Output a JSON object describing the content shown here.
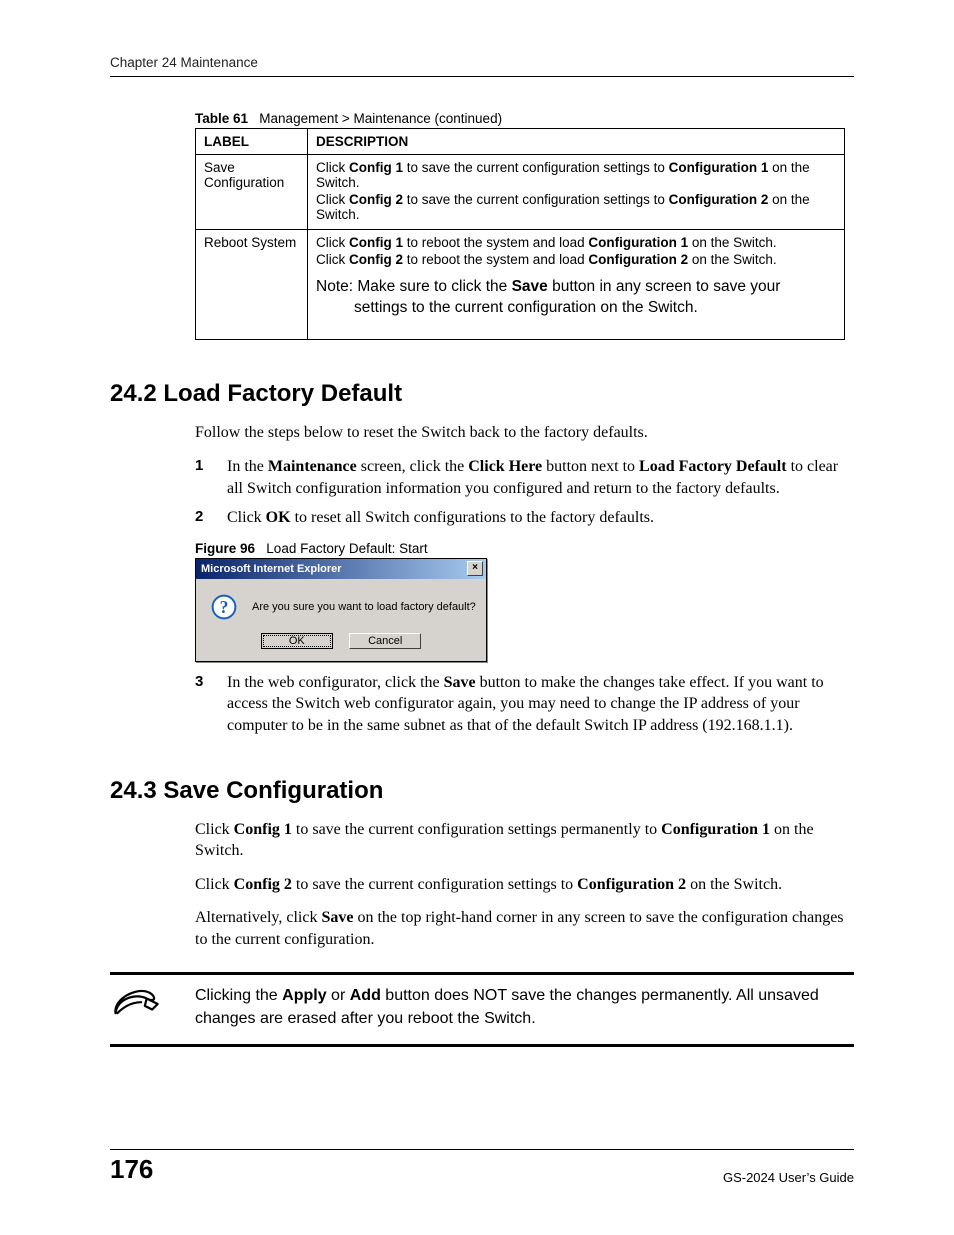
{
  "header": {
    "running": "Chapter 24 Maintenance"
  },
  "table": {
    "caption_label": "Table 61",
    "caption_text": "Management > Maintenance  (continued)",
    "head": {
      "label": "LABEL",
      "desc": "DESCRIPTION"
    },
    "rows": [
      {
        "label": "Save Configuration",
        "d1a": "Click ",
        "d1b": "Config 1",
        "d1c": " to save the current configuration settings to ",
        "d1d": "Configuration 1",
        "d1e": " on the Switch.",
        "d2a": "Click ",
        "d2b": "Config 2",
        "d2c": " to save the current configuration settings to ",
        "d2d": "Configuration 2",
        "d2e": " on the Switch."
      },
      {
        "label": "Reboot System",
        "d1a": "Click ",
        "d1b": "Config 1",
        "d1c": " to reboot the system and load ",
        "d1d": "Configuration 1",
        "d1e": " on the Switch.",
        "d2a": "Click ",
        "d2b": "Config 2",
        "d2c": " to reboot the system and load ",
        "d2d": "Configuration 2",
        "d2e": " on the Switch.",
        "note_a": "Note: Make sure to click the ",
        "note_b": "Save",
        "note_c": " button in any screen to save your settings to the current configuration on the Switch."
      }
    ]
  },
  "sec242": {
    "heading": "24.2  Load Factory Default",
    "intro": "Follow the steps below to reset the Switch back to the factory defaults.",
    "s1a": "In the ",
    "s1b": "Maintenance",
    "s1c": " screen, click the ",
    "s1d": "Click Here",
    "s1e": " button next to ",
    "s1f": "Load Factory Default",
    "s1g": " to clear all Switch configuration information you configured and return to the factory defaults.",
    "s2a": " Click ",
    "s2b": "OK",
    "s2c": " to reset all Switch configurations to the factory defaults.",
    "fig_label": "Figure 96",
    "fig_text": "Load Factory Default: Start",
    "dialog": {
      "title": "Microsoft Internet Explorer",
      "msg": "Are you sure you want to load factory default?",
      "ok": "OK",
      "cancel": "Cancel",
      "close": "×"
    },
    "s3a": "In the web configurator, click the ",
    "s3b": "Save",
    "s3c": " button to make the changes take effect. If you want to access the Switch web configurator again, you may need to change the IP address of your computer to be in the same subnet as that of the default Switch IP address (192.168.1.1)."
  },
  "sec243": {
    "heading": "24.3  Save Configuration",
    "p1a": "Click ",
    "p1b": "Config 1",
    "p1c": " to save the current configuration settings permanently to ",
    "p1d": "Configuration 1",
    "p1e": " on the Switch.",
    "p2a": "Click ",
    "p2b": "Config 2",
    "p2c": " to save the current configuration settings to ",
    "p2d": "Configuration 2",
    "p2e": " on the Switch.",
    "p3a": "Alternatively, click ",
    "p3b": "Save",
    "p3c": " on the top right-hand corner in any screen to save the configuration changes to the current configuration.",
    "note_a": "Clicking the ",
    "note_b": "Apply",
    "note_c": " or ",
    "note_d": "Add",
    "note_e": " button does NOT save the changes permanently. All unsaved changes are erased after you reboot the Switch."
  },
  "footer": {
    "page": "176",
    "guide": "GS-2024 User’s Guide"
  }
}
